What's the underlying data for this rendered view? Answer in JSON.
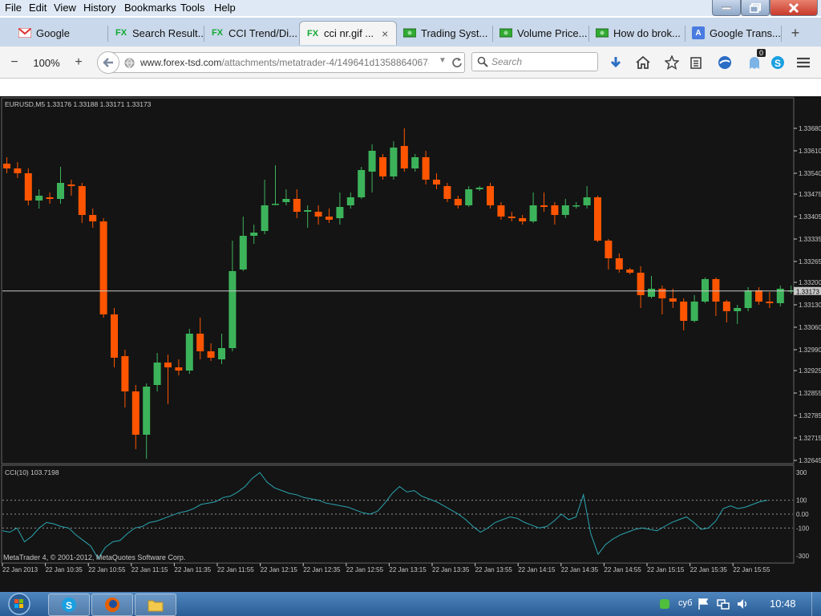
{
  "menu": {
    "items": [
      "File",
      "Edit",
      "View",
      "History",
      "Bookmarks",
      "Tools",
      "Help"
    ]
  },
  "window_controls": {
    "minimize_icon": "minimize-icon",
    "maximize_icon": "restore-icon",
    "close_icon": "close-icon",
    "close_color": "#c8382b"
  },
  "tabs": [
    {
      "label": "Google",
      "icon": "gmail-icon",
      "active": false
    },
    {
      "label": "Search Result...",
      "icon": "fx-icon",
      "active": false
    },
    {
      "label": "CCI Trend/Di...",
      "icon": "fx-icon",
      "active": false
    },
    {
      "label": "cci nr.gif ...",
      "icon": "fx-icon",
      "active": true
    },
    {
      "label": "Trading Syst...",
      "icon": "money-icon",
      "active": false
    },
    {
      "label": "Volume Price...",
      "icon": "money-icon",
      "active": false
    },
    {
      "label": "How do brok...",
      "icon": "money-icon",
      "active": false
    },
    {
      "label": "Google Trans...",
      "icon": "translate-icon",
      "active": false
    }
  ],
  "new_tab_label": "+",
  "toolbar": {
    "zoom_out": "−",
    "zoom_level": "100%",
    "zoom_in": "+",
    "url_domain": "www.forex-tsd.com",
    "url_path": "/attachments/metatrader-4/149641d1358864067-c",
    "search_placeholder": "Search",
    "notification_count": "0"
  },
  "chart": {
    "header": "EURUSD,M5  1.33176 1.33188 1.33171 1.33173",
    "current_price_label": "1.33173",
    "current_price": 1.33173,
    "price_ticks": [
      "1.33680",
      "1.33610",
      "1.33540",
      "1.33475",
      "1.33405",
      "1.33335",
      "1.33265",
      "1.33200",
      "1.33130",
      "1.33060",
      "1.32990",
      "1.32925",
      "1.32855",
      "1.32785",
      "1.32715",
      "1.32645"
    ],
    "cci_header": "CCI(10) 103.7198",
    "cci_ticks": [
      "300",
      "100",
      "0.00",
      "-100",
      "-300"
    ],
    "copyright": "MetaTrader 4, © 2001-2012, MetaQuotes Software Corp.",
    "time_labels": [
      "22 Jan 2013",
      "22 Jan 10:35",
      "22 Jan 10:55",
      "22 Jan 11:15",
      "22 Jan 11:35",
      "22 Jan 11:55",
      "22 Jan 12:15",
      "22 Jan 12:35",
      "22 Jan 12:55",
      "22 Jan 13:15",
      "22 Jan 13:35",
      "22 Jan 13:55",
      "22 Jan 14:15",
      "22 Jan 14:35",
      "22 Jan 14:55",
      "22 Jan 15:15",
      "22 Jan 15:35",
      "22 Jan 15:55"
    ],
    "colors": {
      "background": "#141414",
      "bull": "#3cb35a",
      "bear": "#ff5500",
      "grid_text": "#c8c8c8",
      "cci_line": "#2aa5b0"
    }
  },
  "chart_data": {
    "type": "candlestick",
    "symbol": "EURUSD",
    "timeframe": "M5",
    "ylim": [
      1.32645,
      1.3372
    ],
    "candles": [
      {
        "o": 1.3357,
        "c": 1.33555,
        "h": 1.3359,
        "l": 1.3354
      },
      {
        "o": 1.33555,
        "c": 1.3354,
        "h": 1.33575,
        "l": 1.33525
      },
      {
        "o": 1.3354,
        "c": 1.33455,
        "h": 1.33555,
        "l": 1.3344
      },
      {
        "o": 1.33455,
        "c": 1.3347,
        "h": 1.3349,
        "l": 1.3343
      },
      {
        "o": 1.33465,
        "c": 1.3346,
        "h": 1.3348,
        "l": 1.33445
      },
      {
        "o": 1.3346,
        "c": 1.3351,
        "h": 1.3356,
        "l": 1.33445
      },
      {
        "o": 1.33505,
        "c": 1.335,
        "h": 1.3352,
        "l": 1.3347
      },
      {
        "o": 1.335,
        "c": 1.3341,
        "h": 1.3351,
        "l": 1.33385
      },
      {
        "o": 1.3341,
        "c": 1.3339,
        "h": 1.3343,
        "l": 1.3337
      },
      {
        "o": 1.3339,
        "c": 1.331,
        "h": 1.334,
        "l": 1.3309
      },
      {
        "o": 1.331,
        "c": 1.32965,
        "h": 1.3312,
        "l": 1.32935
      },
      {
        "o": 1.3297,
        "c": 1.3286,
        "h": 1.3299,
        "l": 1.3281
      },
      {
        "o": 1.3286,
        "c": 1.32725,
        "h": 1.3288,
        "l": 1.3268
      },
      {
        "o": 1.32725,
        "c": 1.32875,
        "h": 1.32885,
        "l": 1.3265
      },
      {
        "o": 1.3288,
        "c": 1.3295,
        "h": 1.3298,
        "l": 1.3286
      },
      {
        "o": 1.3295,
        "c": 1.32935,
        "h": 1.32975,
        "l": 1.3282
      },
      {
        "o": 1.32935,
        "c": 1.32925,
        "h": 1.3296,
        "l": 1.3291
      },
      {
        "o": 1.32925,
        "c": 1.3304,
        "h": 1.33055,
        "l": 1.32915
      },
      {
        "o": 1.3304,
        "c": 1.32985,
        "h": 1.3309,
        "l": 1.3296
      },
      {
        "o": 1.32985,
        "c": 1.32965,
        "h": 1.3301,
        "l": 1.32955
      },
      {
        "o": 1.3296,
        "c": 1.32995,
        "h": 1.3304,
        "l": 1.32945
      },
      {
        "o": 1.32995,
        "c": 1.33235,
        "h": 1.3333,
        "l": 1.32985
      },
      {
        "o": 1.3324,
        "c": 1.33345,
        "h": 1.33405,
        "l": 1.33235
      },
      {
        "o": 1.33345,
        "c": 1.33355,
        "h": 1.3338,
        "l": 1.3332
      },
      {
        "o": 1.3336,
        "c": 1.3344,
        "h": 1.3352,
        "l": 1.3335
      },
      {
        "o": 1.33445,
        "c": 1.33445,
        "h": 1.33565,
        "l": 1.3344
      },
      {
        "o": 1.3345,
        "c": 1.3346,
        "h": 1.3349,
        "l": 1.3344
      },
      {
        "o": 1.3346,
        "c": 1.3342,
        "h": 1.3349,
        "l": 1.334
      },
      {
        "o": 1.3342,
        "c": 1.33425,
        "h": 1.3344,
        "l": 1.3337
      },
      {
        "o": 1.3342,
        "c": 1.33405,
        "h": 1.3344,
        "l": 1.3338
      },
      {
        "o": 1.33405,
        "c": 1.33395,
        "h": 1.3343,
        "l": 1.33385
      },
      {
        "o": 1.334,
        "c": 1.33435,
        "h": 1.3348,
        "l": 1.3338
      },
      {
        "o": 1.3344,
        "c": 1.33465,
        "h": 1.3348,
        "l": 1.3343
      },
      {
        "o": 1.33465,
        "c": 1.3355,
        "h": 1.3356,
        "l": 1.3346
      },
      {
        "o": 1.33545,
        "c": 1.3361,
        "h": 1.3363,
        "l": 1.3348
      },
      {
        "o": 1.3359,
        "c": 1.3353,
        "h": 1.336,
        "l": 1.3352
      },
      {
        "o": 1.3353,
        "c": 1.3362,
        "h": 1.3364,
        "l": 1.3352
      },
      {
        "o": 1.33625,
        "c": 1.33555,
        "h": 1.3368,
        "l": 1.33545
      },
      {
        "o": 1.33555,
        "c": 1.3359,
        "h": 1.336,
        "l": 1.33545
      },
      {
        "o": 1.3359,
        "c": 1.3352,
        "h": 1.3361,
        "l": 1.33505
      },
      {
        "o": 1.3352,
        "c": 1.33505,
        "h": 1.3354,
        "l": 1.3349
      },
      {
        "o": 1.335,
        "c": 1.3346,
        "h": 1.3351,
        "l": 1.3345
      },
      {
        "o": 1.3346,
        "c": 1.3344,
        "h": 1.3347,
        "l": 1.3343
      },
      {
        "o": 1.3344,
        "c": 1.3349,
        "h": 1.335,
        "l": 1.33435
      },
      {
        "o": 1.3349,
        "c": 1.33495,
        "h": 1.335,
        "l": 1.33485
      },
      {
        "o": 1.335,
        "c": 1.3344,
        "h": 1.3351,
        "l": 1.3343
      },
      {
        "o": 1.3344,
        "c": 1.33405,
        "h": 1.3345,
        "l": 1.33395
      },
      {
        "o": 1.33405,
        "c": 1.334,
        "h": 1.3342,
        "l": 1.3339
      },
      {
        "o": 1.334,
        "c": 1.3339,
        "h": 1.3341,
        "l": 1.3338
      },
      {
        "o": 1.3339,
        "c": 1.3344,
        "h": 1.3348,
        "l": 1.33385
      },
      {
        "o": 1.3344,
        "c": 1.33435,
        "h": 1.3348,
        "l": 1.3342
      },
      {
        "o": 1.3344,
        "c": 1.3341,
        "h": 1.3345,
        "l": 1.3338
      },
      {
        "o": 1.3341,
        "c": 1.3344,
        "h": 1.3346,
        "l": 1.334
      },
      {
        "o": 1.3344,
        "c": 1.3344,
        "h": 1.3345,
        "l": 1.3343
      },
      {
        "o": 1.3344,
        "c": 1.33465,
        "h": 1.335,
        "l": 1.3343
      },
      {
        "o": 1.33465,
        "c": 1.3333,
        "h": 1.3347,
        "l": 1.33325
      },
      {
        "o": 1.3333,
        "c": 1.33275,
        "h": 1.33335,
        "l": 1.3324
      },
      {
        "o": 1.33275,
        "c": 1.3324,
        "h": 1.3329,
        "l": 1.3323
      },
      {
        "o": 1.3324,
        "c": 1.3323,
        "h": 1.33245,
        "l": 1.33225
      },
      {
        "o": 1.3323,
        "c": 1.3316,
        "h": 1.3325,
        "l": 1.3312
      },
      {
        "o": 1.33155,
        "c": 1.3318,
        "h": 1.3322,
        "l": 1.3315
      },
      {
        "o": 1.3318,
        "c": 1.3315,
        "h": 1.3319,
        "l": 1.331
      },
      {
        "o": 1.3315,
        "c": 1.3314,
        "h": 1.3318,
        "l": 1.3312
      },
      {
        "o": 1.3314,
        "c": 1.3308,
        "h": 1.3315,
        "l": 1.3305
      },
      {
        "o": 1.3308,
        "c": 1.3314,
        "h": 1.3316,
        "l": 1.33075
      },
      {
        "o": 1.3314,
        "c": 1.3321,
        "h": 1.33215,
        "l": 1.33135
      },
      {
        "o": 1.3321,
        "c": 1.3314,
        "h": 1.33215,
        "l": 1.33095
      },
      {
        "o": 1.3314,
        "c": 1.3311,
        "h": 1.33145,
        "l": 1.33075
      },
      {
        "o": 1.3311,
        "c": 1.3312,
        "h": 1.3313,
        "l": 1.3307
      },
      {
        "o": 1.3312,
        "c": 1.33175,
        "h": 1.33185,
        "l": 1.3311
      },
      {
        "o": 1.33175,
        "c": 1.3314,
        "h": 1.33185,
        "l": 1.3313
      },
      {
        "o": 1.3314,
        "c": 1.33135,
        "h": 1.3317,
        "l": 1.3312
      },
      {
        "o": 1.33135,
        "c": 1.3318,
        "h": 1.3319,
        "l": 1.33125
      },
      {
        "o": 1.33175,
        "c": 1.33175,
        "h": 1.3319,
        "l": 1.33165
      }
    ],
    "cci": {
      "name": "CCI(10)",
      "ylim": [
        -330,
        330
      ],
      "levels": [
        100,
        0,
        -100
      ],
      "values": [
        -120,
        -130,
        -100,
        -200,
        -160,
        -100,
        -60,
        -70,
        -90,
        -100,
        -150,
        -190,
        -230,
        -320,
        -240,
        -200,
        -190,
        -140,
        -100,
        -90,
        -60,
        -50,
        -30,
        -10,
        10,
        20,
        40,
        70,
        80,
        90,
        120,
        130,
        160,
        200,
        260,
        300,
        230,
        190,
        170,
        150,
        140,
        120,
        110,
        100,
        80,
        70,
        60,
        50,
        30,
        10,
        0,
        20,
        80,
        150,
        200,
        160,
        170,
        130,
        110,
        90,
        60,
        30,
        0,
        -40,
        -90,
        -130,
        -100,
        -60,
        -40,
        -20,
        -30,
        -60,
        -80,
        -100,
        -90,
        -50,
        0,
        -40,
        -20,
        140,
        -140,
        -290,
        -220,
        -180,
        -150,
        -130,
        -110,
        -100,
        -110,
        -120,
        -90,
        -60,
        -40,
        -20,
        -60,
        -110,
        -100,
        -50,
        40,
        60,
        40,
        50,
        70,
        90,
        100
      ]
    }
  },
  "taskbar": {
    "clock": "10:48",
    "lang": "суб",
    "apps": [
      "skype-icon",
      "firefox-icon",
      "explorer-icon"
    ]
  }
}
